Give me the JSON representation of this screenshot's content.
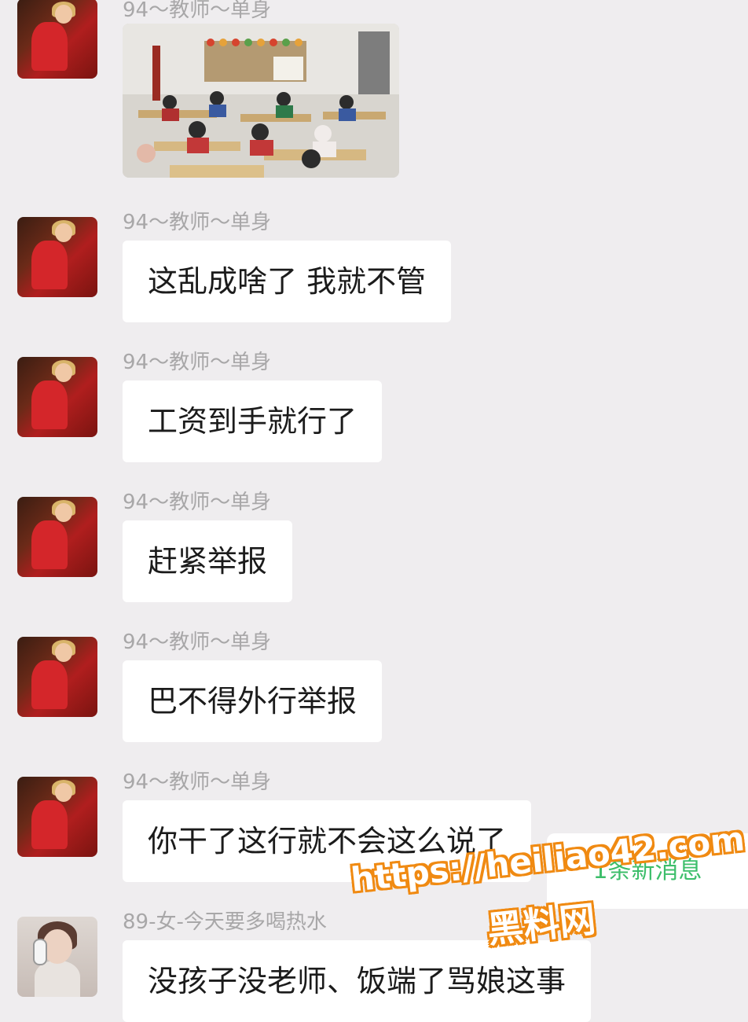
{
  "messages": [
    {
      "sender": "94～教师～单身",
      "type": "image",
      "image": "classroom-photo"
    },
    {
      "sender": "94～教师～单身",
      "type": "text",
      "text": "这乱成啥了 我就不管"
    },
    {
      "sender": "94～教师～单身",
      "type": "text",
      "text": "工资到手就行了"
    },
    {
      "sender": "94～教师～单身",
      "type": "text",
      "text": "赶紧举报"
    },
    {
      "sender": "94～教师～单身",
      "type": "text",
      "text": "巴不得外行举报"
    },
    {
      "sender": "94～教师～单身",
      "type": "text",
      "text": "你干了这行就不会这么说了"
    },
    {
      "sender": "89-女-今天要多喝热水",
      "type": "text",
      "text": "没孩子没老师、饭端了骂娘这事"
    }
  ],
  "new_message_button": "1条新消息",
  "watermark": {
    "url": "https://heiliao42.com",
    "name": "黑料网"
  },
  "colors": {
    "background": "#efedef",
    "bubble": "#ffffff",
    "new_message_text": "#3cbe6a",
    "watermark_outline": "#f08a12"
  }
}
